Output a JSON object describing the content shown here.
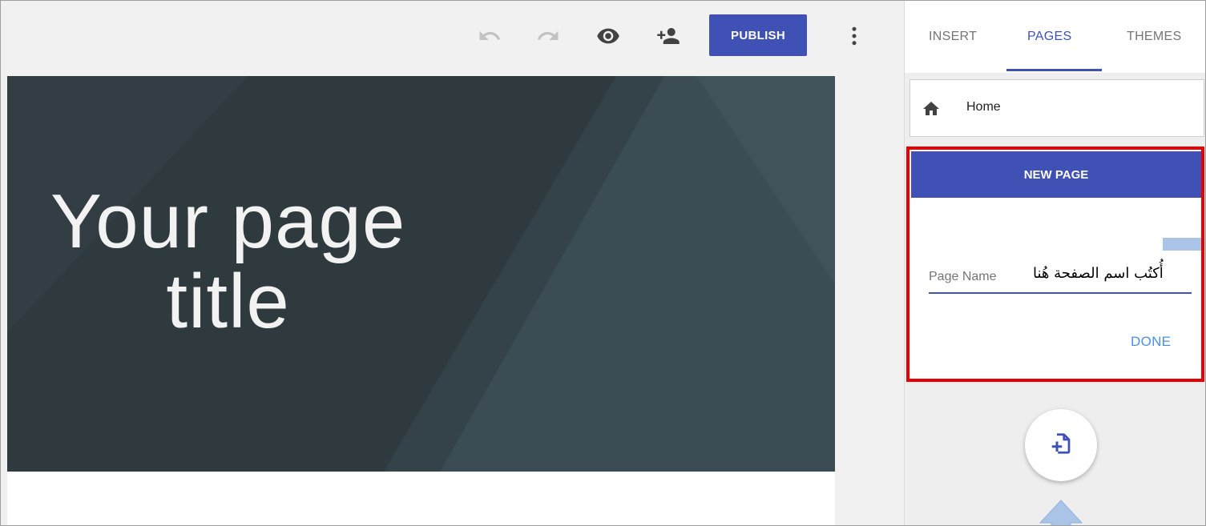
{
  "toolbar": {
    "undo_icon": "undo-icon",
    "redo_icon": "redo-icon",
    "preview_icon": "eye-icon",
    "share_icon": "person-add-icon",
    "publish_label": "PUBLISH",
    "more_icon": "more-vertical-icon",
    "accent_color": "#3f51b5"
  },
  "hero": {
    "title_line1": "Your page",
    "title_line2": "title",
    "background_color": "#2f3b40"
  },
  "panel": {
    "tabs": [
      {
        "label": "INSERT",
        "active": false
      },
      {
        "label": "PAGES",
        "active": true
      },
      {
        "label": "THEMES",
        "active": false
      }
    ],
    "home_page": {
      "icon": "home-icon",
      "label": "Home"
    },
    "new_page": {
      "header": "NEW PAGE",
      "field_placeholder": "Page Name",
      "annotation": "أُكتُب اسم الصفحة هُنا",
      "done_label": "DONE",
      "highlight_color": "#e60000"
    },
    "add_page_icon": "add-page-icon",
    "pointer_arrow_icon": "up-arrow-icon"
  }
}
